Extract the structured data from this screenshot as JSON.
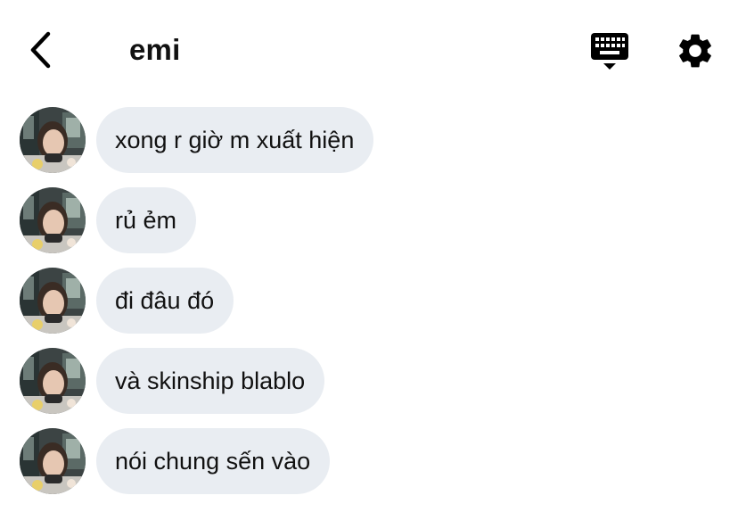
{
  "header": {
    "title": "emi",
    "back_icon": "chevron-left-icon",
    "keyboard_icon": "keyboard-icon",
    "settings_icon": "gear-icon"
  },
  "colors": {
    "bubble_background": "#e9edf2",
    "text": "#111111",
    "icon": "#000000",
    "background": "#ffffff"
  },
  "messages": [
    {
      "text": "xong r giờ m xuất hiện"
    },
    {
      "text": "rủ ẻm"
    },
    {
      "text": "đi đâu đó"
    },
    {
      "text": "và skinship blablo"
    },
    {
      "text": "nói chung sến vào"
    }
  ]
}
